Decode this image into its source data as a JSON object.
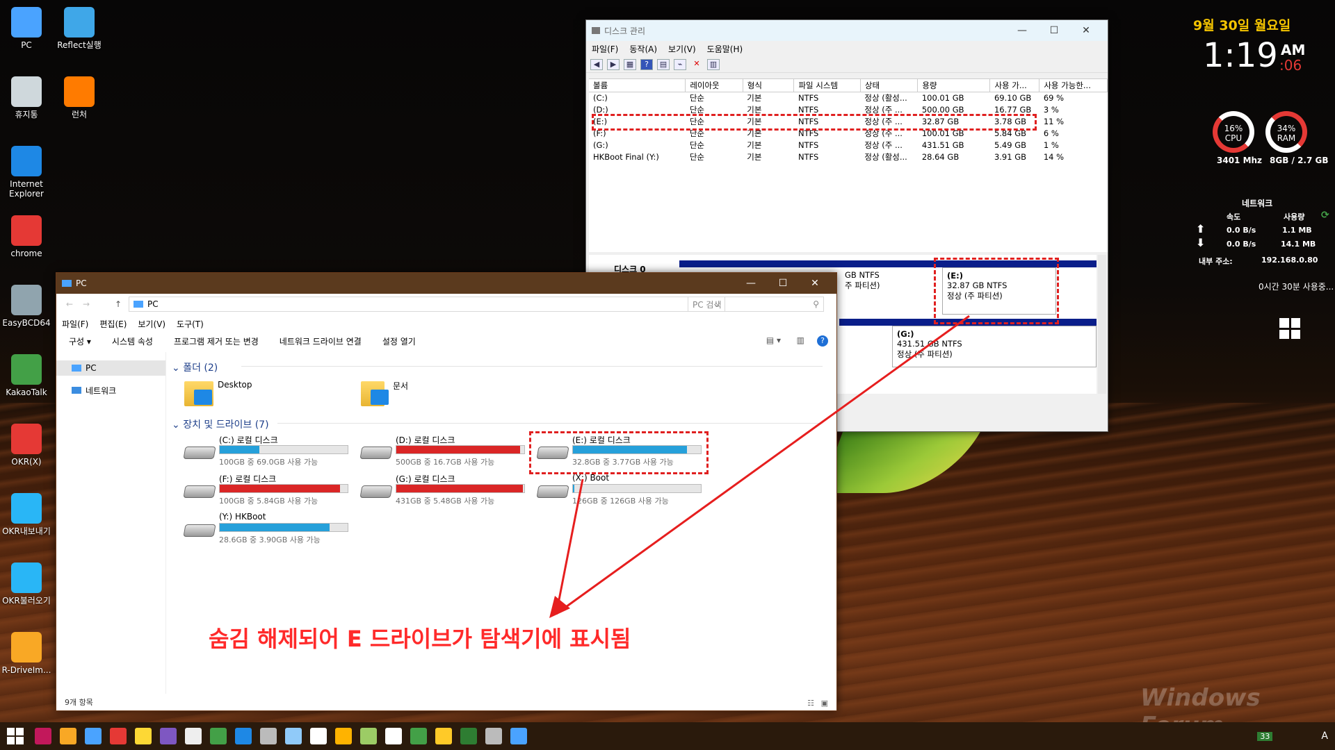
{
  "desktop": {
    "icons": [
      {
        "label": "PC",
        "color": "#4aa3ff"
      },
      {
        "label": "Reflect실행",
        "color": "#3fa7e8"
      },
      {
        "label": "휴지통",
        "color": "#cfd8dc"
      },
      {
        "label": "런처",
        "color": "#ff7b00"
      },
      {
        "label": "Internet Explorer",
        "color": "#1e88e5"
      },
      {
        "label": "chrome",
        "color": "#e53935"
      },
      {
        "label": "EasyBCD64",
        "color": "#90a4ae"
      },
      {
        "label": "KakaoTalk",
        "color": "#43a047"
      },
      {
        "label": "OKR(X)",
        "color": "#e53935"
      },
      {
        "label": "OKR내보내기",
        "color": "#29b6f6"
      },
      {
        "label": "OKR불러오기",
        "color": "#29b6f6"
      },
      {
        "label": "R-DriveIm...",
        "color": "#f9a825"
      }
    ]
  },
  "clock": {
    "date": "9월 30일 월요일",
    "time": "1:19",
    "ampm": "AM",
    "seconds": ":06"
  },
  "sysmon": {
    "cpu_pct": "16%",
    "cpu_label": "CPU",
    "ram_pct": "34%",
    "ram_label": "RAM",
    "cpu_mhz": "3401 Mhz",
    "ram_info": "8GB / 2.7 GB",
    "net_title": "네트워크",
    "speed_label": "속도",
    "usage_label": "사용량",
    "up_speed": "0.0 B/s",
    "up_usage": "1.1 MB",
    "down_speed": "0.0 B/s",
    "down_usage": "14.1 MB",
    "ip_label": "내부 주소:",
    "ip": "192.168.0.80",
    "uptime": "0시간 30분 사용중..."
  },
  "watermark": "Windows Forum",
  "diskmgmt": {
    "title": "디스크 관리",
    "menu": [
      "파일(F)",
      "동작(A)",
      "보기(V)",
      "도움말(H)"
    ],
    "headers": [
      "볼륨",
      "레이아웃",
      "형식",
      "파일 시스템",
      "상태",
      "용량",
      "사용 가...",
      "사용 가능한..."
    ],
    "rows": [
      [
        "(C:)",
        "단순",
        "기본",
        "NTFS",
        "정상 (활성...",
        "100.01 GB",
        "69.10 GB",
        "69 %"
      ],
      [
        "(D:)",
        "단순",
        "기본",
        "NTFS",
        "정상 (주 ...",
        "500.00 GB",
        "16.77 GB",
        "3 %"
      ],
      [
        "(E:)",
        "단순",
        "기본",
        "NTFS",
        "정상 (주 ...",
        "32.87 GB",
        "3.78 GB",
        "11 %"
      ],
      [
        "(F:)",
        "단순",
        "기본",
        "NTFS",
        "정상 (주 ...",
        "100.01 GB",
        "5.84 GB",
        "6 %"
      ],
      [
        "(G:)",
        "단순",
        "기본",
        "NTFS",
        "정상 (주 ...",
        "431.51 GB",
        "5.49 GB",
        "1 %"
      ],
      [
        "HKBoot Final (Y:)",
        "단순",
        "기본",
        "NTFS",
        "정상 (활성...",
        "28.64 GB",
        "3.91 GB",
        "14 %"
      ]
    ],
    "disk0_label": "디스크 0",
    "part_partial_a": "GB NTFS",
    "part_partial_b": "주 파티션)",
    "e_part": {
      "name": "(E:)",
      "size": "32.87 GB NTFS",
      "status": "정상 (주 파티션)"
    },
    "g_part": {
      "name": "(G:)",
      "size": "431.51 GB NTFS",
      "status": "정상 (주 파티션)"
    }
  },
  "explorer": {
    "title": "PC",
    "address": "PC",
    "search_placeholder": "PC 검색",
    "menu": [
      "파일(F)",
      "편집(E)",
      "보기(V)",
      "도구(T)"
    ],
    "commands": [
      "구성 ▾",
      "시스템 속성",
      "프로그램 제거 또는 변경",
      "네트워크 드라이브 연결",
      "설정 열기"
    ],
    "nav": [
      "PC",
      "네트워크"
    ],
    "folders_header": "폴더 (2)",
    "folders": [
      "Desktop",
      "문서"
    ],
    "drives_header": "장치 및 드라이브 (7)",
    "drives": [
      {
        "name": "(C:) 로컬 디스크",
        "size": "100GB 중 69.0GB 사용 가능",
        "used": 0.31,
        "color": "#26a0da"
      },
      {
        "name": "(D:) 로컬 디스크",
        "size": "500GB 중 16.7GB 사용 가능",
        "used": 0.97,
        "color": "#da2626"
      },
      {
        "name": "(E:) 로컬 디스크",
        "size": "32.8GB 중 3.77GB 사용 가능",
        "used": 0.89,
        "color": "#26a0da"
      },
      {
        "name": "(F:) 로컬 디스크",
        "size": "100GB 중 5.84GB 사용 가능",
        "used": 0.94,
        "color": "#da2626"
      },
      {
        "name": "(G:) 로컬 디스크",
        "size": "431GB 중 5.48GB 사용 가능",
        "used": 0.99,
        "color": "#da2626"
      },
      {
        "name": "(X:) Boot",
        "size": "126GB 중 126GB 사용 가능",
        "used": 0.01,
        "color": "#26a0da"
      },
      {
        "name": "(Y:) HKBoot",
        "size": "28.6GB 중 3.90GB 사용 가능",
        "used": 0.86,
        "color": "#26a0da"
      }
    ],
    "status": "9개 항목"
  },
  "annotation": "숨김 해제되어 E 드라이브가 탐색기에 표시됨",
  "taskbar": {
    "tray_time": "33",
    "ime": "A"
  }
}
